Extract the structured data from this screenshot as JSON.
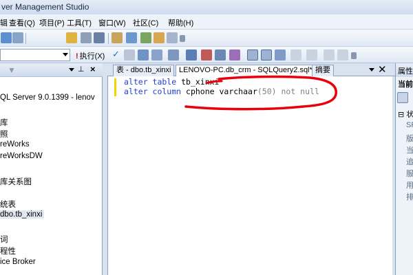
{
  "window": {
    "title": "ver Management Studio"
  },
  "menu": {
    "items": [
      "辑",
      "查看(Q)",
      "项目(P)",
      "工具(T)",
      "窗口(W)",
      "社区(C)",
      "帮助(H)"
    ]
  },
  "toolbar": {
    "database_value": "",
    "execute_label": "执行(X)"
  },
  "object_explorer": {
    "items": [
      "QL Server 9.0.1399 - lenov",
      "库",
      "照",
      "reWorks",
      "reWorksDW",
      "库关系图",
      "统表",
      "dbo.tb_xinxi",
      "词",
      "程性",
      "ice Broker"
    ],
    "selected": "dbo.tb_xinxi"
  },
  "tabs": [
    {
      "label": "表 - dbo.tb_xinxi"
    },
    {
      "label": "LENOVO-PC.db_crm - SQLQuery2.sql*"
    },
    {
      "label": "摘要"
    }
  ],
  "editor": {
    "line1": {
      "kw": "alter table",
      "rest": " tb_xinxi"
    },
    "line2": {
      "kw": "alter column",
      "rest": " cphone varchaar",
      "tail": "(50) not null"
    }
  },
  "properties": {
    "title": "属性",
    "current": "当前",
    "section": "状",
    "rows": [
      "SF",
      "版",
      "当",
      "追",
      "服",
      "用",
      "排"
    ]
  },
  "colors": {
    "annotation_red": "#e8000a",
    "keyword_blue": "#1f3fd8"
  }
}
